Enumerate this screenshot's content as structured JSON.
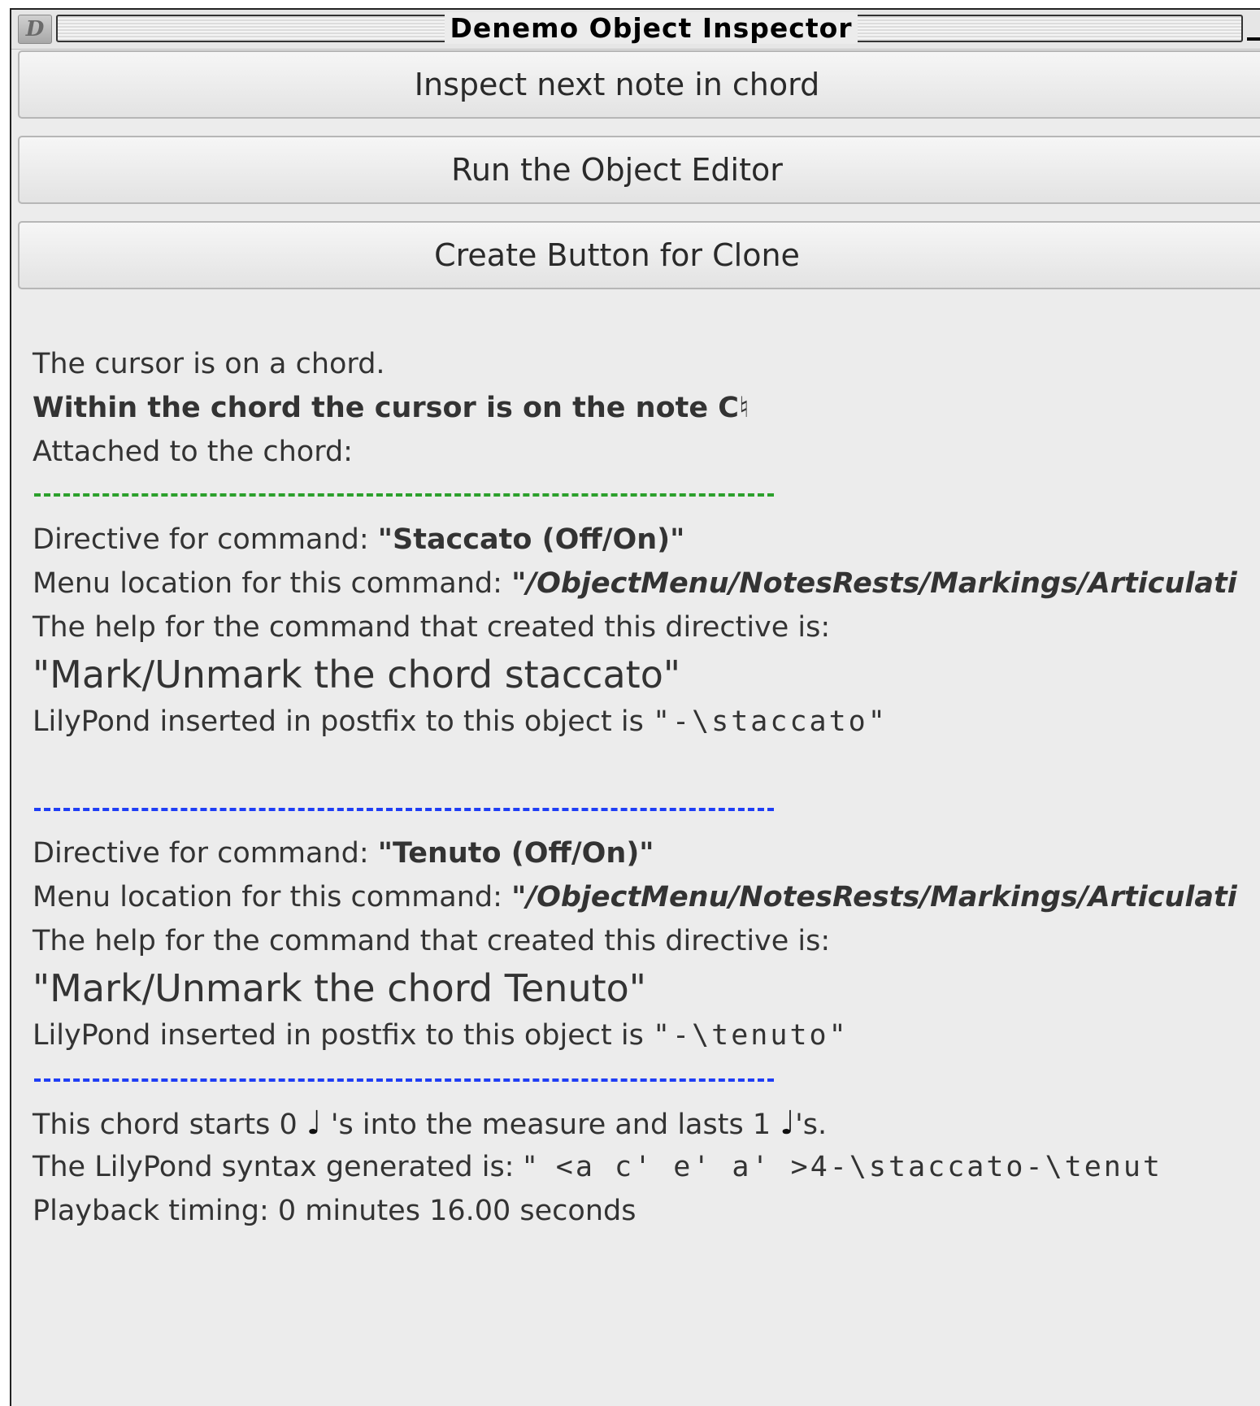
{
  "window": {
    "title": "Denemo Object Inspector",
    "app_icon": "denemo-app-icon"
  },
  "buttons": {
    "inspect_next": "Inspect next note in chord",
    "run_editor": "Run the Object Editor",
    "create_clone": "Create Button for Clone"
  },
  "info": {
    "cursor_on": "The cursor is on a chord.",
    "within_chord": "Within the chord the cursor is on the note C♮",
    "attached": "Attached to the chord:"
  },
  "directives": [
    {
      "command_prefix": "Directive for command: ",
      "command_name": "\"Staccato (Off/On)\"",
      "menu_prefix": "Menu location for this command: ",
      "menu_path": "\"/ObjectMenu/NotesRests/Markings/Articulati",
      "help_intro": "The help for the command that created this directive is:",
      "help_text": "\"Mark/Unmark the chord staccato\"",
      "lily_prefix": "LilyPond inserted in postfix to this object is ",
      "lily_value": "\"-\\staccato\""
    },
    {
      "command_prefix": "Directive for command: ",
      "command_name": "\"Tenuto (Off/On)\"",
      "menu_prefix": "Menu location for this command: ",
      "menu_path": "\"/ObjectMenu/NotesRests/Markings/Articulati",
      "help_intro": "The help for the command that created this directive is:",
      "help_text": "\"Mark/Unmark the chord Tenuto\"",
      "lily_prefix": "LilyPond inserted in postfix to this object is ",
      "lily_value": "\"-\\tenuto\""
    }
  ],
  "timing": {
    "starts_prefix": "This chord starts 0 ",
    "starts_mid": " 's into the measure and lasts 1 ",
    "starts_suffix": "'s.",
    "note_icon": "quarter-note-icon",
    "syntax_prefix": "The LilyPond syntax generated is: \"",
    "syntax_value": " <a c' e' a' >4-\\staccato-\\tenut",
    "playback": "Playback timing: 0 minutes 16.00 seconds"
  },
  "colors": {
    "separator_first": "#2ca02c",
    "separator_rest": "#1f3ef5",
    "background": "#ececec"
  }
}
